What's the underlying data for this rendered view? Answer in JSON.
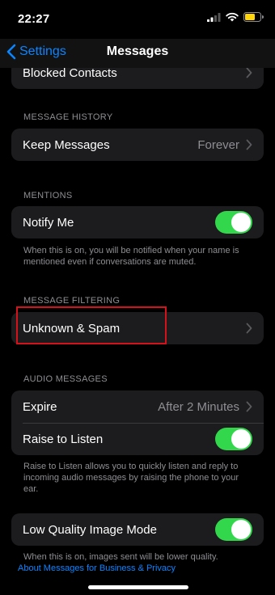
{
  "status_bar": {
    "time": "22:27"
  },
  "nav": {
    "back_label": "Settings",
    "title": "Messages"
  },
  "rows": {
    "blocked_contacts": {
      "label": "Blocked Contacts"
    },
    "keep_messages": {
      "label": "Keep Messages",
      "value": "Forever"
    },
    "notify_me": {
      "label": "Notify Me",
      "on": true
    },
    "unknown_spam": {
      "label": "Unknown & Spam"
    },
    "expire": {
      "label": "Expire",
      "value": "After 2 Minutes"
    },
    "raise_to_listen": {
      "label": "Raise to Listen",
      "on": true
    },
    "low_quality": {
      "label": "Low Quality Image Mode",
      "on": true
    }
  },
  "sections": {
    "message_history": "MESSAGE HISTORY",
    "mentions": "MENTIONS",
    "message_filtering": "MESSAGE FILTERING",
    "audio_messages": "AUDIO MESSAGES"
  },
  "footnotes": {
    "mentions": "When this is on, you will be notified when your name is mentioned even if conversations are muted.",
    "audio": "Raise to Listen allows you to quickly listen and reply to incoming audio messages by raising the phone to your ear.",
    "low_quality": "When this is on, images sent will be lower quality."
  },
  "link": "About Messages for Business & Privacy",
  "colors": {
    "accent": "#0a84ff",
    "toggle_on": "#32d74b",
    "highlight": "#d4121b",
    "battery": "#ffd60a"
  }
}
